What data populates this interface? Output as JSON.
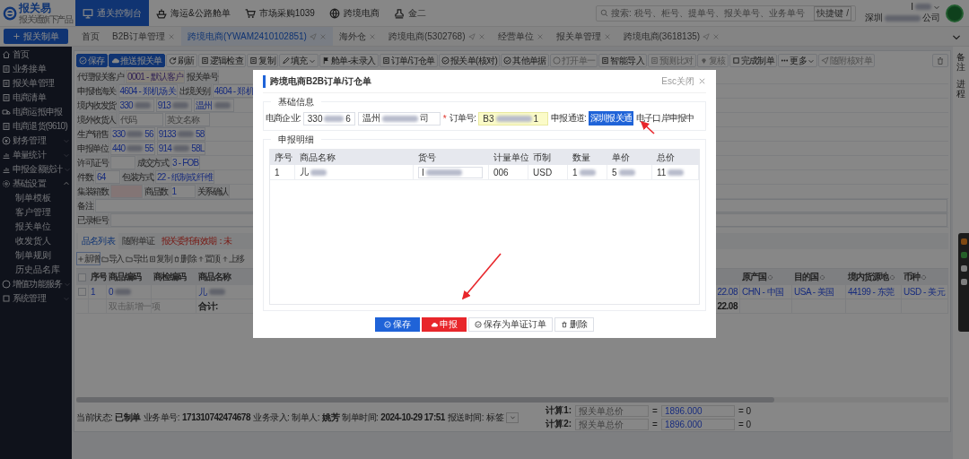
{
  "header": {
    "logo": {
      "name": "报关易",
      "tagline": "报关通旗下产品"
    },
    "nav": [
      {
        "label": "通关控制台",
        "selected": true
      },
      {
        "label": "海运&公路舱单",
        "selected": false
      },
      {
        "label": "市场采购1039",
        "selected": false
      },
      {
        "label": "跨境电商",
        "selected": false
      },
      {
        "label": "金二",
        "selected": false
      }
    ],
    "search": {
      "placeholder": "搜索: 税号、柜号、提单号、报关单号、业务单号",
      "shortcut": "快捷键 /"
    },
    "user": {
      "name": "I",
      "company_start": "深圳",
      "company_end": "公司"
    }
  },
  "create_button": "报关制单",
  "tabs": [
    {
      "label": "首页",
      "selected": false,
      "closable": false,
      "pinned": false
    },
    {
      "label": "B2B订单管理",
      "selected": false,
      "closable": true,
      "pinned": false
    },
    {
      "label": "跨境电商(YWAM2410102851)",
      "selected": true,
      "closable": true,
      "pinned": true
    },
    {
      "label": "海外仓",
      "selected": false,
      "closable": true,
      "pinned": false
    },
    {
      "label": "跨境电商(5302768)",
      "selected": false,
      "closable": true,
      "pinned": true
    },
    {
      "label": "经营单位",
      "selected": false,
      "closable": true,
      "pinned": false
    },
    {
      "label": "报关单管理",
      "selected": false,
      "closable": true,
      "pinned": false
    },
    {
      "label": "跨境电商(3618135)",
      "selected": false,
      "closable": true,
      "pinned": true
    }
  ],
  "sidebar": [
    {
      "label": "首页"
    },
    {
      "label": "业务接单"
    },
    {
      "label": "报关单管理"
    },
    {
      "label": "电商清单"
    },
    {
      "label": "电商运抵申报"
    },
    {
      "label": "电商退货(9610)"
    },
    {
      "label": "财务管理",
      "expanded": false
    },
    {
      "label": "单量统计",
      "expanded": false
    },
    {
      "label": "申报金额统计",
      "expanded": false
    },
    {
      "label": "基础设置",
      "expanded": true,
      "children": [
        {
          "label": "制单模板"
        },
        {
          "label": "客户管理"
        },
        {
          "label": "报关单位"
        },
        {
          "label": "收发货人"
        },
        {
          "label": "制单规则"
        },
        {
          "label": "历史品名库"
        }
      ]
    },
    {
      "label": "增值功能服务",
      "expanded": false
    },
    {
      "label": "系统管理",
      "expanded": false
    }
  ],
  "toolbar": [
    {
      "label": "保存",
      "kind": "primary",
      "disabled": false
    },
    {
      "label": "推送报关单",
      "kind": "primary",
      "disabled": false
    },
    {
      "label": "刷新",
      "kind": "plain",
      "disabled": false
    },
    {
      "label": "逻辑检查",
      "kind": "plain",
      "disabled": false
    },
    {
      "label": "复制",
      "kind": "plain",
      "disabled": false
    },
    {
      "label": "填充",
      "kind": "dropdown",
      "disabled": false
    },
    {
      "label": "舱单-未录入",
      "kind": "plain",
      "disabled": false
    },
    {
      "label": "订单/订仓单",
      "kind": "plain",
      "disabled": false
    },
    {
      "label": "报关单(核对)",
      "kind": "plain",
      "disabled": false
    },
    {
      "label": "其他单据",
      "kind": "plain",
      "disabled": false
    },
    {
      "label": "打开单一",
      "kind": "plain",
      "disabled": true
    },
    {
      "label": "智能导入",
      "kind": "plain",
      "disabled": false
    },
    {
      "label": "预测比对",
      "kind": "plain",
      "disabled": true
    },
    {
      "label": "复核",
      "kind": "plain",
      "disabled": true
    },
    {
      "label": "完成制单",
      "kind": "plain",
      "disabled": false
    },
    {
      "label": "更多",
      "kind": "dropdown",
      "disabled": false
    },
    {
      "label": "随附核对单",
      "kind": "plain",
      "disabled": true
    }
  ],
  "form": [
    [
      {
        "kind": "label",
        "text": "代理报关客户"
      },
      {
        "kind": "value",
        "text": "0001 - 默认客户",
        "highlighted": true
      },
      {
        "kind": "label",
        "text": "报关单号"
      }
    ],
    [
      {
        "kind": "label",
        "text": "申报地海关"
      },
      {
        "kind": "value",
        "text": "4604 - 郑机场关"
      },
      {
        "kind": "label",
        "text": "出境关别"
      },
      {
        "kind": "value",
        "text": "4604 - 郑机"
      }
    ],
    [
      {
        "kind": "label",
        "text": "境内收发货"
      },
      {
        "kind": "value",
        "text": "330",
        "blurred": true
      },
      {
        "kind": "value",
        "text": "913",
        "blurred": true
      },
      {
        "kind": "value",
        "text": "温州",
        "blurred": true
      }
    ],
    [
      {
        "kind": "label",
        "text": "境外收货人"
      },
      {
        "kind": "value",
        "placeholder": "代码"
      },
      {
        "kind": "value",
        "placeholder": "英文名称"
      }
    ],
    [
      {
        "kind": "label",
        "text": "生产销售"
      },
      {
        "kind": "value",
        "text": "330",
        "tail": "56",
        "blurred": true
      },
      {
        "kind": "value",
        "text": "9133",
        "tail": "58",
        "blurred": true
      }
    ],
    [
      {
        "kind": "label",
        "text": "申报单位"
      },
      {
        "kind": "value",
        "text": "440",
        "tail": "55",
        "blurred": true
      },
      {
        "kind": "value",
        "text": "914",
        "tail": "58L",
        "blurred": true
      }
    ],
    [
      {
        "kind": "label",
        "text": "许可证号"
      },
      {
        "kind": "value"
      },
      {
        "kind": "label",
        "text": "成交方式"
      },
      {
        "kind": "value",
        "text": "3 - FOB"
      }
    ],
    [
      {
        "kind": "label",
        "text": "件数"
      },
      {
        "kind": "value",
        "text": "64"
      },
      {
        "kind": "label",
        "text": "包装方式"
      },
      {
        "kind": "value",
        "text": "22 - 纸制或纤维"
      }
    ],
    [
      {
        "kind": "label",
        "text": "集装箱数"
      },
      {
        "kind": "value",
        "invalid": true
      },
      {
        "kind": "label",
        "text": "商品数"
      },
      {
        "kind": "value",
        "text": "1"
      },
      {
        "kind": "label",
        "text": "关系确认"
      }
    ],
    [
      {
        "kind": "label",
        "text": "备注"
      },
      {
        "kind": "value",
        "wide": true
      }
    ],
    [
      {
        "kind": "label",
        "text": "已录柜号"
      },
      {
        "kind": "value",
        "wide": true
      }
    ]
  ],
  "items": {
    "tabs": [
      {
        "label": "品名列表",
        "selected": true
      },
      {
        "label": "随附单证",
        "selected": false
      }
    ],
    "warning": "报关委托有效期：未",
    "toolbar": [
      {
        "label": "新增"
      },
      {
        "label": "导入"
      },
      {
        "label": "导出"
      },
      {
        "label": "复制"
      },
      {
        "label": "删除"
      },
      {
        "label": "置顶"
      },
      {
        "label": "上移"
      }
    ],
    "columns": [
      {
        "kind": "checkbox",
        "checked": false
      },
      {
        "kind": "text",
        "label": "序号"
      },
      {
        "kind": "text",
        "label": "商品编码"
      },
      {
        "kind": "text",
        "label": "商检编码"
      },
      {
        "kind": "text",
        "label": "商品名称"
      },
      {
        "kind": "blank"
      },
      {
        "kind": "setting",
        "label": "原产国"
      },
      {
        "kind": "setting",
        "label": "目的国"
      },
      {
        "kind": "setting",
        "label": "境内货源地"
      },
      {
        "kind": "setting",
        "label": "币种"
      }
    ],
    "rows": [
      {
        "kind": "item",
        "cells": [
          {
            "checked": false
          },
          {
            "text": "1"
          },
          {
            "text": "0",
            "blurred": true
          },
          {},
          {
            "text": "儿",
            "blurred": true
          },
          {
            "text": "22.08"
          },
          {
            "text": "CHN - 中国"
          },
          {
            "text": "USA - 美国"
          },
          {
            "text": "44199 - 东莞"
          },
          {
            "text": "USD - 美元"
          }
        ]
      },
      {
        "kind": "sum",
        "cells": [
          {},
          {},
          {
            "text": "双击新增一项"
          },
          {},
          {
            "text": "合计:"
          },
          {
            "text": "22.08"
          },
          {},
          {},
          {},
          {}
        ]
      }
    ]
  },
  "status": {
    "fields": [
      {
        "label": "当前状态:",
        "value": "已制单"
      },
      {
        "label": "业务单号:",
        "value": "171310742474678"
      },
      {
        "label": "业务录入:"
      },
      {
        "label": "制单人:",
        "value": "姚芳"
      },
      {
        "label": "制单时间:",
        "value": "2024-10-29 17:51"
      },
      {
        "label": "报送时间:"
      },
      {
        "label": "标签"
      }
    ],
    "calcs": [
      {
        "label": "计算1:",
        "placeholder": "报关单总价",
        "op": "=",
        "value": "1896.000",
        "result": "= 0"
      },
      {
        "label": "计算2:",
        "placeholder": "报关单总价",
        "op": "=",
        "value": "1896.000",
        "result": "= 0"
      }
    ]
  },
  "right_panel": [
    "备注",
    "进程"
  ],
  "modal": {
    "title": "跨境电商B2B订单/订仓单",
    "esc_hint": "Esc关闭",
    "basic": {
      "legend": "基础信息",
      "company_label": "电商企业:",
      "company_code": {
        "text": "330",
        "tail": "6",
        "blurred": true
      },
      "company_name": {
        "text": "温州",
        "tail": "司",
        "blurred": true
      },
      "order_mark": "*",
      "order_label": "订单号:",
      "order_no": {
        "text": "B3",
        "tail": "1",
        "blurred": true
      },
      "channel_label": "申报通道:",
      "channel_button": "深圳报关通",
      "status": "电子口岸申报中"
    },
    "detail": {
      "legend": "申报明细",
      "columns": [
        "序号",
        "商品名称",
        "货号",
        "计量单位",
        "币制",
        "数量",
        "单价",
        "总价"
      ],
      "rows": [
        [
          {
            "text": "1"
          },
          {
            "text": "儿",
            "blurred": true
          },
          {
            "text": "I",
            "blurred": true,
            "kind": "input"
          },
          {
            "text": "006"
          },
          {
            "text": "USD"
          },
          {
            "text": "1",
            "blurred": true
          },
          {
            "text": "5",
            "blurred": true
          },
          {
            "text": "11",
            "blurred": true
          }
        ]
      ]
    },
    "buttons": [
      {
        "label": "保存",
        "kind": "primary"
      },
      {
        "label": "申报",
        "kind": "danger"
      },
      {
        "label": "保存为单证订单",
        "kind": "default"
      },
      {
        "label": "删除",
        "kind": "default"
      }
    ]
  }
}
